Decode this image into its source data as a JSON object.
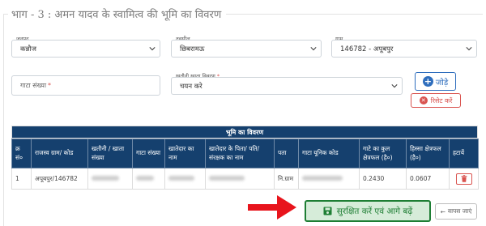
{
  "section": {
    "title": "भाग - 3 : अमन यादव के स्वामित्व की भूमि का विवरण"
  },
  "filters": {
    "district": {
      "label": "जनपद",
      "value": "कन्नौज"
    },
    "tehsil": {
      "label": "तहसील",
      "value": "छिबरामऊ"
    },
    "village": {
      "label": "ग्राम",
      "value": "146782 - अपूबपुर"
    }
  },
  "gata": {
    "placeholder": "गाटा संख्या",
    "required_mark": "*"
  },
  "khatauni": {
    "label": "खतौनी खाता विवरण",
    "required_mark": "*",
    "value": "चयन करे"
  },
  "buttons": {
    "add": "जोड़े",
    "reset": "रिसेट करें",
    "save": "सुरक्षित करें एवं आगे बढ़ें",
    "back": "वापस जाएं"
  },
  "table": {
    "caption": "भूमि का विवरण",
    "headers": [
      "क्र सं०",
      "राजस्व ग्राम/ कोड",
      "खतौनी / खाता संख्या",
      "गाटा संख्या",
      "खातेदार का नाम",
      "खातेदार के पिता/ पति/ संरक्षक का नाम",
      "पता",
      "गाटा यूनिक कोड",
      "गाटे का कुल क्षेत्रफल (है०)",
      "हिस्सा क्षेत्रफल (है०)",
      "हटायें"
    ],
    "rows": [
      {
        "sno": "1",
        "village": "अपूबपुर/146782",
        "address": "नि.ग्राम",
        "total_area": "0.2430",
        "share_area": "0.0607"
      }
    ]
  },
  "colors": {
    "header_bg": "#15406e",
    "primary": "#2f6ebd",
    "danger": "#d9534f",
    "success": "#1e7e34",
    "arrow": "#e8141c"
  },
  "icons": [
    "chevron-down-icon",
    "plus-circle-icon",
    "x-circle-icon",
    "trash-icon",
    "save-icon",
    "arrow-left-icon",
    "red-arrow-icon"
  ]
}
